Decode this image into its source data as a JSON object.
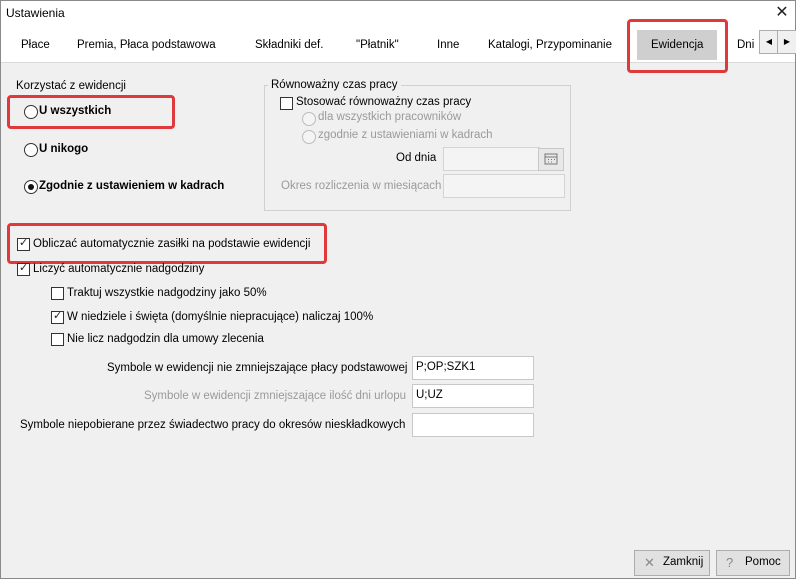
{
  "window": {
    "title": "Ustawienia"
  },
  "tabs": [
    "Płace",
    "Premia, Płaca podstawowa",
    "Składniki def.",
    "\"Płatnik\"",
    "Inne",
    "Katalogi, Przypominanie",
    "Ewidencja",
    "Dni"
  ],
  "active_tab": "Ewidencja",
  "evidence_usage": {
    "label": "Korzystać z ewidencji",
    "options": [
      "U wszystkich",
      "U nikogo",
      "Zgodnie z ustawieniem w kadrach"
    ],
    "selected": "Zgodnie z ustawieniem w kadrach"
  },
  "equivalent_time": {
    "legend": "Równoważny czas pracy",
    "checkbox_label": "Stosować równoważny czas pracy",
    "checked": false,
    "option_all": "dla wszystkich pracowników",
    "option_hr": "zgodnie z ustawieniami w kadrach",
    "from_label": "Od dnia",
    "from_value": "",
    "period_label": "Okres rozliczenia w miesiącach",
    "period_value": ""
  },
  "checkboxes": {
    "allowances": {
      "label": "Obliczać automatycznie zasiłki na podstawie ewidencji",
      "checked": true
    },
    "overtime": {
      "label": "Liczyć automatycznie nadgodziny",
      "checked": true
    },
    "overtime_50": {
      "label": "Traktuj wszystkie nadgodziny jako 50%",
      "checked": false
    },
    "holidays_100": {
      "label": "W niedziele i święta (domyślnie niepracujące) naliczaj 100%",
      "checked": true
    },
    "no_overtime_contract": {
      "label": "Nie licz nadgodzin dla umowy zlecenia",
      "checked": false
    }
  },
  "symbols": {
    "not_reducing_label": "Symbole w ewidencji nie zmniejszające płacy podstawowej",
    "not_reducing_value": "P;OP;SZK1",
    "vacation_label": "Symbole w ewidencji zmniejszające ilość dni urlopu",
    "vacation_value": "U;UZ",
    "certificate_label": "Symbole niepobierane przez świadectwo pracy do okresów nieskładkowych",
    "certificate_value": ""
  },
  "buttons": {
    "close": "Zamknij",
    "help": "Pomoc"
  },
  "colors": {
    "highlight": "#e0393b",
    "dialog_bg": "#f0f0f0",
    "active_tab_bg": "#cfcfcf"
  }
}
